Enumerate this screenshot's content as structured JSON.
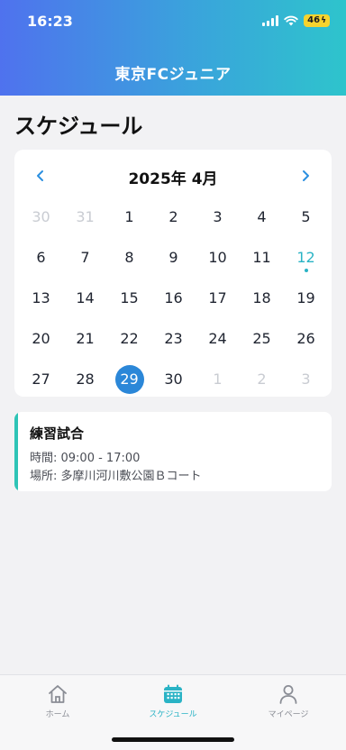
{
  "status_bar": {
    "time": "16:23",
    "battery": "46"
  },
  "header": {
    "title": "東京FCジュニア"
  },
  "page": {
    "title": "スケジュール"
  },
  "calendar": {
    "month_label": "2025年 4月",
    "prev_icon": "chevron-left-icon",
    "next_icon": "chevron-right-icon",
    "selected_day": "29",
    "today_day": "12",
    "weeks": [
      [
        {
          "d": "30",
          "m": true
        },
        {
          "d": "31",
          "m": true
        },
        {
          "d": "1"
        },
        {
          "d": "2"
        },
        {
          "d": "3"
        },
        {
          "d": "4"
        },
        {
          "d": "5"
        }
      ],
      [
        {
          "d": "6"
        },
        {
          "d": "7"
        },
        {
          "d": "8"
        },
        {
          "d": "9"
        },
        {
          "d": "10"
        },
        {
          "d": "11"
        },
        {
          "d": "12",
          "today": true
        }
      ],
      [
        {
          "d": "13"
        },
        {
          "d": "14"
        },
        {
          "d": "15"
        },
        {
          "d": "16"
        },
        {
          "d": "17"
        },
        {
          "d": "18"
        },
        {
          "d": "19"
        }
      ],
      [
        {
          "d": "20"
        },
        {
          "d": "21"
        },
        {
          "d": "22"
        },
        {
          "d": "23"
        },
        {
          "d": "24"
        },
        {
          "d": "25"
        },
        {
          "d": "26"
        }
      ],
      [
        {
          "d": "27"
        },
        {
          "d": "28"
        },
        {
          "d": "29",
          "selected": true
        },
        {
          "d": "30"
        },
        {
          "d": "1",
          "m": true
        },
        {
          "d": "2",
          "m": true
        },
        {
          "d": "3",
          "m": true
        }
      ]
    ]
  },
  "event": {
    "title": "練習試合",
    "time": "時間: 09:00 - 17:00",
    "place": "場所: 多摩川河川敷公園Ｂコート"
  },
  "tabs": [
    {
      "label": "ホーム",
      "icon": "home-icon",
      "active": false
    },
    {
      "label": "スケジュール",
      "icon": "calendar-icon",
      "active": true
    },
    {
      "label": "マイページ",
      "icon": "person-icon",
      "active": false
    }
  ],
  "colors": {
    "accent": "#2ab3c5",
    "selected": "#2b87d8",
    "header_start": "#4f72ee",
    "header_end": "#2ec4cc"
  }
}
